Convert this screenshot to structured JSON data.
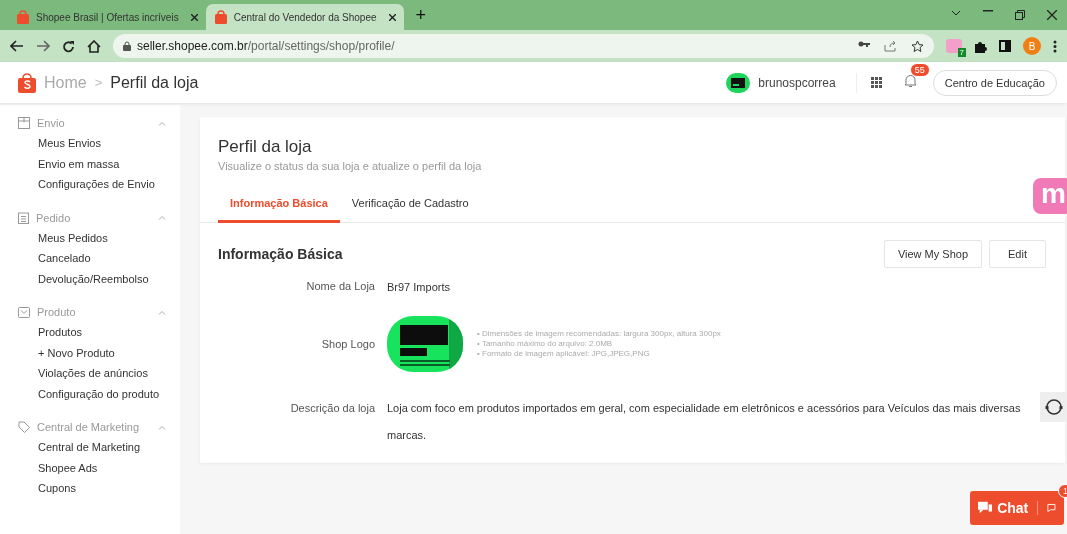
{
  "browser": {
    "tabs": [
      {
        "title": "Shopee Brasil | Ofertas incríveis",
        "selected": false
      },
      {
        "title": "Central do Vendedor da Shopee",
        "selected": true
      }
    ],
    "new_tab": "+",
    "url_host": "seller.shopee.com.br",
    "url_path": "/portal/settings/shop/profile/",
    "extension_badge": "7",
    "profile_initial": "B"
  },
  "header": {
    "breadcrumb": [
      "Home",
      "Perfil da loja"
    ],
    "separator": ">",
    "username": "brunospcorrea",
    "notification_count": "55",
    "education_button": "Centro de Educação"
  },
  "sidebar": {
    "groups": [
      {
        "title": "Envio",
        "expanded": true,
        "items": [
          "Meus Envios",
          "Envio em massa",
          "Configurações de Envio"
        ]
      },
      {
        "title": "Pedido",
        "expanded": true,
        "items": [
          "Meus Pedidos",
          "Cancelado",
          "Devolução/Reembolso"
        ]
      },
      {
        "title": "Produto",
        "expanded": true,
        "items": [
          "Produtos",
          "+ Novo Produto",
          "Violações de anúncios",
          "Configuração do produto"
        ]
      },
      {
        "title": "Central de Marketing",
        "expanded": true,
        "items": [
          "Central de Marketing",
          "Shopee Ads",
          "Cupons"
        ]
      }
    ]
  },
  "page": {
    "title": "Perfil da loja",
    "subtitle": "Visualize o status da sua loja e atualize o perfil da loja",
    "tabs": [
      {
        "label": "Informação Básica",
        "selected": true
      },
      {
        "label": "Verificação de Cadastro",
        "selected": false
      }
    ],
    "section_title": "Informação Básica",
    "buttons": [
      "View My Shop",
      "Edit"
    ],
    "fields": [
      {
        "kind": "text",
        "label": "Nome da Loja",
        "value": "Br97 Imports"
      },
      {
        "kind": "logo",
        "label": "Shop Logo",
        "hints": [
          "• Dimensões de imagem recomendadas: largura 300px, altura 300px",
          "• Tamanho máximo do arquivo: 2.0MB",
          "• Formato de imagem aplicável: JPG,JPEG,PNG"
        ]
      },
      {
        "kind": "text",
        "label": "Descrição da loja",
        "value": "Loja com foco em produtos importados em geral, com especialidade em eletrônicos e acessórios para Veículos das mais diversas marcas."
      }
    ]
  },
  "floating": {
    "extension_letter": "m",
    "chat_label": "Chat",
    "chat_badge": "1"
  }
}
